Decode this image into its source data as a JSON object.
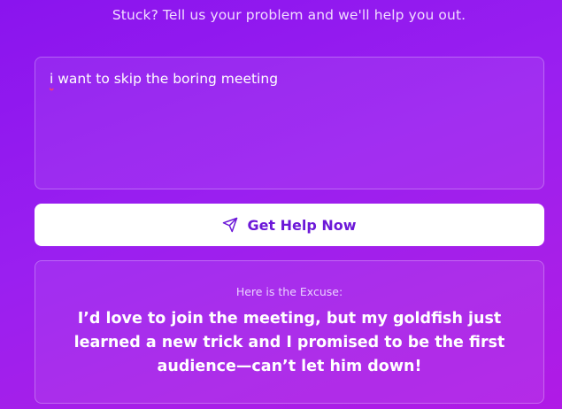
{
  "tagline": "Stuck? Tell us your problem and we'll help you out.",
  "problem_input": {
    "first_word": "i",
    "rest": " want to skip the boring meeting"
  },
  "button": {
    "label": "Get Help Now",
    "icon": "send-icon"
  },
  "excuse": {
    "heading": "Here is the Excuse:",
    "text": "I’d love to join the meeting, but my goldfish just learned a new trick and I promised to be the first audience—can’t let him down!"
  },
  "colors": {
    "accent": "#6c18d8",
    "background_start": "#8a14ee",
    "background_end": "#b01ae6"
  }
}
